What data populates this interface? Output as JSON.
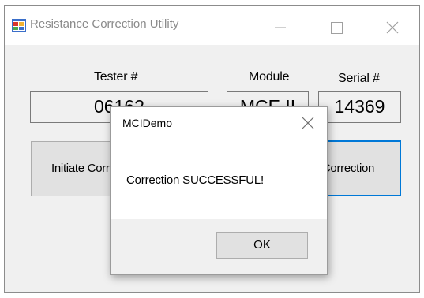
{
  "window": {
    "title": "Resistance Correction Utility",
    "icon": "app-window-icon"
  },
  "labels": {
    "tester": "Tester #",
    "module": "Module",
    "serial": "Serial #"
  },
  "fields": {
    "tester": "06162",
    "module": "MCE II",
    "serial": "14369"
  },
  "buttons": {
    "initiate": "Initiate Correction",
    "apply": "Apply Correction"
  },
  "dialog": {
    "title": "MCIDemo",
    "message": "Correction SUCCESSFUL!",
    "ok_label": "OK"
  },
  "colors": {
    "focus_border": "#0078d7",
    "window_bg": "#f0f0f0",
    "title_text": "#8a8a8a"
  }
}
